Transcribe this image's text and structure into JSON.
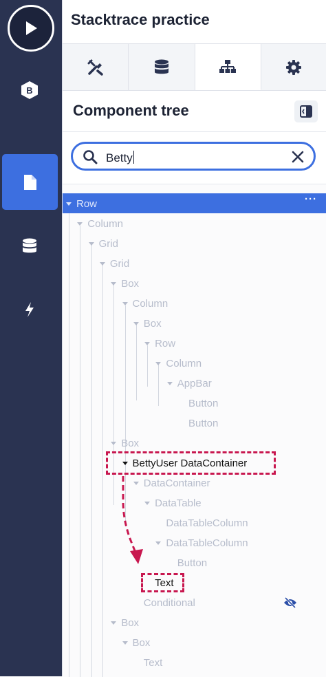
{
  "app": {
    "title": "Stacktrace practice"
  },
  "sidebar": {
    "items": [
      {
        "icon": "play-icon",
        "active": false
      },
      {
        "icon": "betty-logo-icon",
        "active": false
      },
      {
        "icon": "page-icon",
        "active": true
      },
      {
        "icon": "database-icon",
        "active": false
      },
      {
        "icon": "lightning-icon",
        "active": false
      }
    ]
  },
  "tabs": [
    {
      "icon": "tools-icon",
      "active": false
    },
    {
      "icon": "database-icon",
      "active": false
    },
    {
      "icon": "hierarchy-icon",
      "active": true
    },
    {
      "icon": "gear-icon",
      "active": false
    }
  ],
  "section": {
    "title": "Component tree",
    "toggle_icon": "panel-toggle-icon"
  },
  "search": {
    "value": "Betty",
    "icon": "search-icon",
    "clear_icon": "close-icon"
  },
  "tree": {
    "nodes": [
      {
        "label": "Row",
        "depth": 0,
        "expanded": true,
        "selected": true
      },
      {
        "label": "Column",
        "depth": 1,
        "expanded": true
      },
      {
        "label": "Grid",
        "depth": 2,
        "expanded": true
      },
      {
        "label": "Grid",
        "depth": 3,
        "expanded": true
      },
      {
        "label": "Box",
        "depth": 4,
        "expanded": true
      },
      {
        "label": "Column",
        "depth": 5,
        "expanded": true
      },
      {
        "label": "Box",
        "depth": 6,
        "expanded": true
      },
      {
        "label": "Row",
        "depth": 7,
        "expanded": true
      },
      {
        "label": "Column",
        "depth": 8,
        "expanded": true
      },
      {
        "label": "AppBar",
        "depth": 9,
        "expanded": true
      },
      {
        "label": "Button",
        "depth": 10,
        "expanded": false
      },
      {
        "label": "Button",
        "depth": 10,
        "expanded": false
      },
      {
        "label": "Box",
        "depth": 4,
        "expanded": true
      },
      {
        "label": "BettyUser DataContainer",
        "depth": 5,
        "expanded": true,
        "highlight": true
      },
      {
        "label": "DataContainer",
        "depth": 6,
        "expanded": true
      },
      {
        "label": "DataTable",
        "depth": 7,
        "expanded": true
      },
      {
        "label": "DataTableColumn",
        "depth": 8,
        "expanded": false
      },
      {
        "label": "DataTableColumn",
        "depth": 8,
        "expanded": true
      },
      {
        "label": "Button",
        "depth": 9,
        "expanded": false
      },
      {
        "label": "Text",
        "depth": 7,
        "expanded": false,
        "highlight": true
      },
      {
        "label": "Conditional",
        "depth": 6,
        "expanded": false,
        "hidden_icon": "eye-slash-icon"
      },
      {
        "label": "Box",
        "depth": 4,
        "expanded": true
      },
      {
        "label": "Box",
        "depth": 5,
        "expanded": true
      },
      {
        "label": "Text",
        "depth": 6,
        "expanded": false
      }
    ],
    "row_menu_label": "···"
  },
  "colors": {
    "rail": "#2a3351",
    "accent": "#3d6fe0",
    "highlight": "#c8174f",
    "muted_text": "#b6bccb"
  }
}
